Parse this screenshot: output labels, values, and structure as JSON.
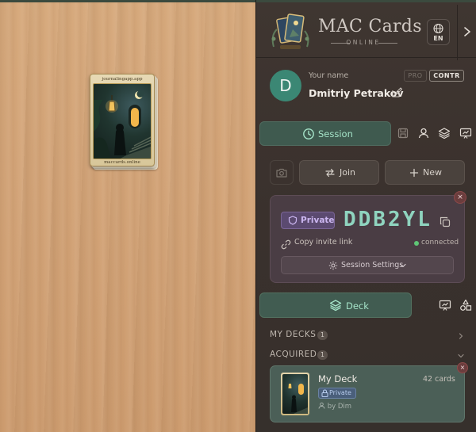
{
  "table": {
    "card": {
      "top_caption": "journalingapp.app",
      "bottom_caption": "maccards.online"
    }
  },
  "header": {
    "title": "MAC Cards",
    "subtitle": "ONLINE",
    "language": "EN",
    "icons": {
      "logo": "tarot-cards-logo-icon",
      "language": "globe-icon",
      "collapse": "chevron-right-icon"
    }
  },
  "user": {
    "avatar_letter": "D",
    "name_label": "Your name",
    "name": "Dmitriy Petrakov",
    "badges": {
      "pro": "PRO",
      "contr": "CONTR"
    }
  },
  "session": {
    "tab_label": "Session",
    "join_label": "Join",
    "new_label": "New",
    "privacy": "Private",
    "code": "DDB2YL",
    "copy_link_label": "Copy invite link",
    "status": "connected",
    "settings_label": "Session Settings",
    "close_symbol": "×"
  },
  "deck": {
    "tab_label": "Deck",
    "sections": [
      {
        "title": "MY DECKS",
        "count": "1"
      },
      {
        "title": "ACQUIRED",
        "count": "1"
      }
    ],
    "item": {
      "name": "My Deck",
      "count": "42 cards",
      "privacy": "Private",
      "author": "by Dim",
      "close_symbol": "×"
    }
  },
  "colors": {
    "accent": "#a5e3c8",
    "panel": "#3a312d",
    "avatar": "#3b8774",
    "code": "#8fd4bf",
    "private_badge": "#cbb6f0",
    "connected": "#5fc676"
  }
}
